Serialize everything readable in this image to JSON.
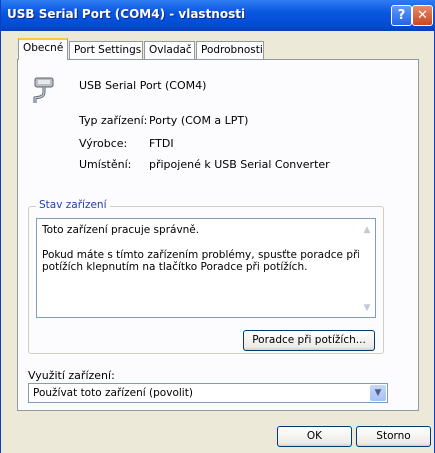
{
  "window": {
    "title": "USB Serial Port (COM4)  - vlastnosti"
  },
  "titlebar": {
    "help_glyph": "?",
    "close_glyph": "✕"
  },
  "tabs": [
    {
      "label": "Obecné"
    },
    {
      "label": "Port Settings"
    },
    {
      "label": "Ovladač"
    },
    {
      "label": "Podrobnosti"
    }
  ],
  "device": {
    "icon": "serial-port-icon",
    "name": "USB Serial Port (COM4)",
    "type_label": "Typ zařízení:",
    "type_value": "Porty (COM a LPT)",
    "manufacturer_label": "Výrobce:",
    "manufacturer_value": "FTDI",
    "location_label": "Umístění:",
    "location_value": "připojené k USB Serial Converter"
  },
  "status": {
    "legend": "Stav zařízení",
    "line1": "Toto zařízení pracuje správně.",
    "line2": "Pokud máte s tímto zařízením problémy, spusťte poradce při",
    "line3": "potížích klepnutím na tlačítko Poradce při potížích.",
    "troubleshoot_button": "Poradce při potížích..."
  },
  "usage": {
    "label": "Využití zařízení:",
    "selected": "Používat toto zařízení (povolit)"
  },
  "buttons": {
    "ok": "OK",
    "cancel": "Storno"
  },
  "colors": {
    "titlebar": "#0a57e0",
    "accent_tab": "#ffc83c",
    "legend": "#1f3fa8"
  }
}
